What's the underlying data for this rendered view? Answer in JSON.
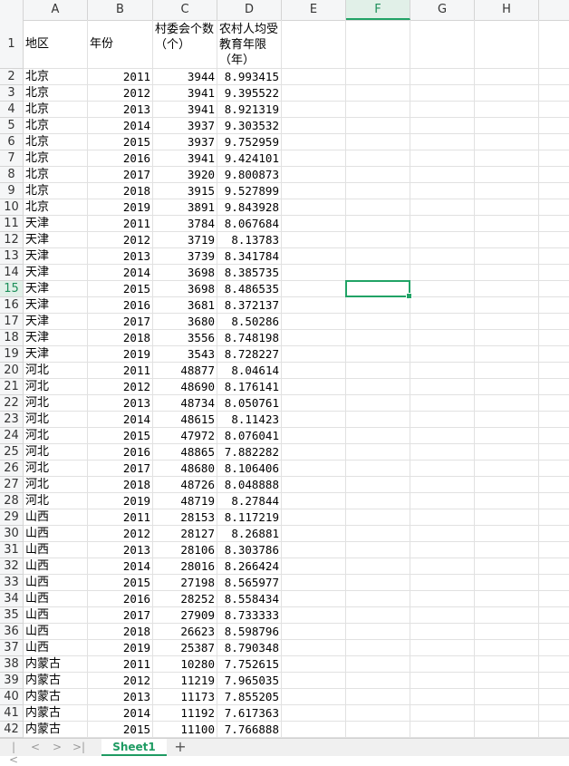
{
  "columns": [
    "A",
    "B",
    "C",
    "D",
    "E",
    "F",
    "G",
    "H"
  ],
  "active_column": "F",
  "active_row": 15,
  "header_row": {
    "row": 1,
    "region": "地区",
    "year": "年份",
    "villages": "村委会个数（个）",
    "education": "农村人均受教育年限（年）"
  },
  "rows": [
    {
      "n": 2,
      "region": "北京",
      "year": "2011",
      "villages": "3944",
      "education": "8.993415"
    },
    {
      "n": 3,
      "region": "北京",
      "year": "2012",
      "villages": "3941",
      "education": "9.395522"
    },
    {
      "n": 4,
      "region": "北京",
      "year": "2013",
      "villages": "3941",
      "education": "8.921319"
    },
    {
      "n": 5,
      "region": "北京",
      "year": "2014",
      "villages": "3937",
      "education": "9.303532"
    },
    {
      "n": 6,
      "region": "北京",
      "year": "2015",
      "villages": "3937",
      "education": "9.752959"
    },
    {
      "n": 7,
      "region": "北京",
      "year": "2016",
      "villages": "3941",
      "education": "9.424101"
    },
    {
      "n": 8,
      "region": "北京",
      "year": "2017",
      "villages": "3920",
      "education": "9.800873"
    },
    {
      "n": 9,
      "region": "北京",
      "year": "2018",
      "villages": "3915",
      "education": "9.527899"
    },
    {
      "n": 10,
      "region": "北京",
      "year": "2019",
      "villages": "3891",
      "education": "9.843928"
    },
    {
      "n": 11,
      "region": "天津",
      "year": "2011",
      "villages": "3784",
      "education": "8.067684"
    },
    {
      "n": 12,
      "region": "天津",
      "year": "2012",
      "villages": "3719",
      "education": "8.13783"
    },
    {
      "n": 13,
      "region": "天津",
      "year": "2013",
      "villages": "3739",
      "education": "8.341784"
    },
    {
      "n": 14,
      "region": "天津",
      "year": "2014",
      "villages": "3698",
      "education": "8.385735"
    },
    {
      "n": 15,
      "region": "天津",
      "year": "2015",
      "villages": "3698",
      "education": "8.486535"
    },
    {
      "n": 16,
      "region": "天津",
      "year": "2016",
      "villages": "3681",
      "education": "8.372137"
    },
    {
      "n": 17,
      "region": "天津",
      "year": "2017",
      "villages": "3680",
      "education": "8.50286"
    },
    {
      "n": 18,
      "region": "天津",
      "year": "2018",
      "villages": "3556",
      "education": "8.748198"
    },
    {
      "n": 19,
      "region": "天津",
      "year": "2019",
      "villages": "3543",
      "education": "8.728227"
    },
    {
      "n": 20,
      "region": "河北",
      "year": "2011",
      "villages": "48877",
      "education": "8.04614"
    },
    {
      "n": 21,
      "region": "河北",
      "year": "2012",
      "villages": "48690",
      "education": "8.176141"
    },
    {
      "n": 22,
      "region": "河北",
      "year": "2013",
      "villages": "48734",
      "education": "8.050761"
    },
    {
      "n": 23,
      "region": "河北",
      "year": "2014",
      "villages": "48615",
      "education": "8.11423"
    },
    {
      "n": 24,
      "region": "河北",
      "year": "2015",
      "villages": "47972",
      "education": "8.076041"
    },
    {
      "n": 25,
      "region": "河北",
      "year": "2016",
      "villages": "48865",
      "education": "7.882282"
    },
    {
      "n": 26,
      "region": "河北",
      "year": "2017",
      "villages": "48680",
      "education": "8.106406"
    },
    {
      "n": 27,
      "region": "河北",
      "year": "2018",
      "villages": "48726",
      "education": "8.048888"
    },
    {
      "n": 28,
      "region": "河北",
      "year": "2019",
      "villages": "48719",
      "education": "8.27844"
    },
    {
      "n": 29,
      "region": "山西",
      "year": "2011",
      "villages": "28153",
      "education": "8.117219"
    },
    {
      "n": 30,
      "region": "山西",
      "year": "2012",
      "villages": "28127",
      "education": "8.26881"
    },
    {
      "n": 31,
      "region": "山西",
      "year": "2013",
      "villages": "28106",
      "education": "8.303786"
    },
    {
      "n": 32,
      "region": "山西",
      "year": "2014",
      "villages": "28016",
      "education": "8.266424"
    },
    {
      "n": 33,
      "region": "山西",
      "year": "2015",
      "villages": "27198",
      "education": "8.565977"
    },
    {
      "n": 34,
      "region": "山西",
      "year": "2016",
      "villages": "28252",
      "education": "8.558434"
    },
    {
      "n": 35,
      "region": "山西",
      "year": "2017",
      "villages": "27909",
      "education": "8.733333"
    },
    {
      "n": 36,
      "region": "山西",
      "year": "2018",
      "villages": "26623",
      "education": "8.598796"
    },
    {
      "n": 37,
      "region": "山西",
      "year": "2019",
      "villages": "25387",
      "education": "8.790348"
    },
    {
      "n": 38,
      "region": "内蒙古",
      "year": "2011",
      "villages": "10280",
      "education": "7.752615"
    },
    {
      "n": 39,
      "region": "内蒙古",
      "year": "2012",
      "villages": "11219",
      "education": "7.965035"
    },
    {
      "n": 40,
      "region": "内蒙古",
      "year": "2013",
      "villages": "11173",
      "education": "7.855205"
    },
    {
      "n": 41,
      "region": "内蒙古",
      "year": "2014",
      "villages": "11192",
      "education": "7.617363"
    },
    {
      "n": 42,
      "region": "内蒙古",
      "year": "2015",
      "villages": "11100",
      "education": "7.766888"
    }
  ],
  "tabs": {
    "sheet_name": "Sheet1",
    "add_label": "+",
    "nav": [
      "|<",
      "<",
      ">",
      ">|"
    ]
  },
  "colors": {
    "accent": "#21a366",
    "grid": "#e1e1e1",
    "header_bg": "#f5f6f7"
  }
}
